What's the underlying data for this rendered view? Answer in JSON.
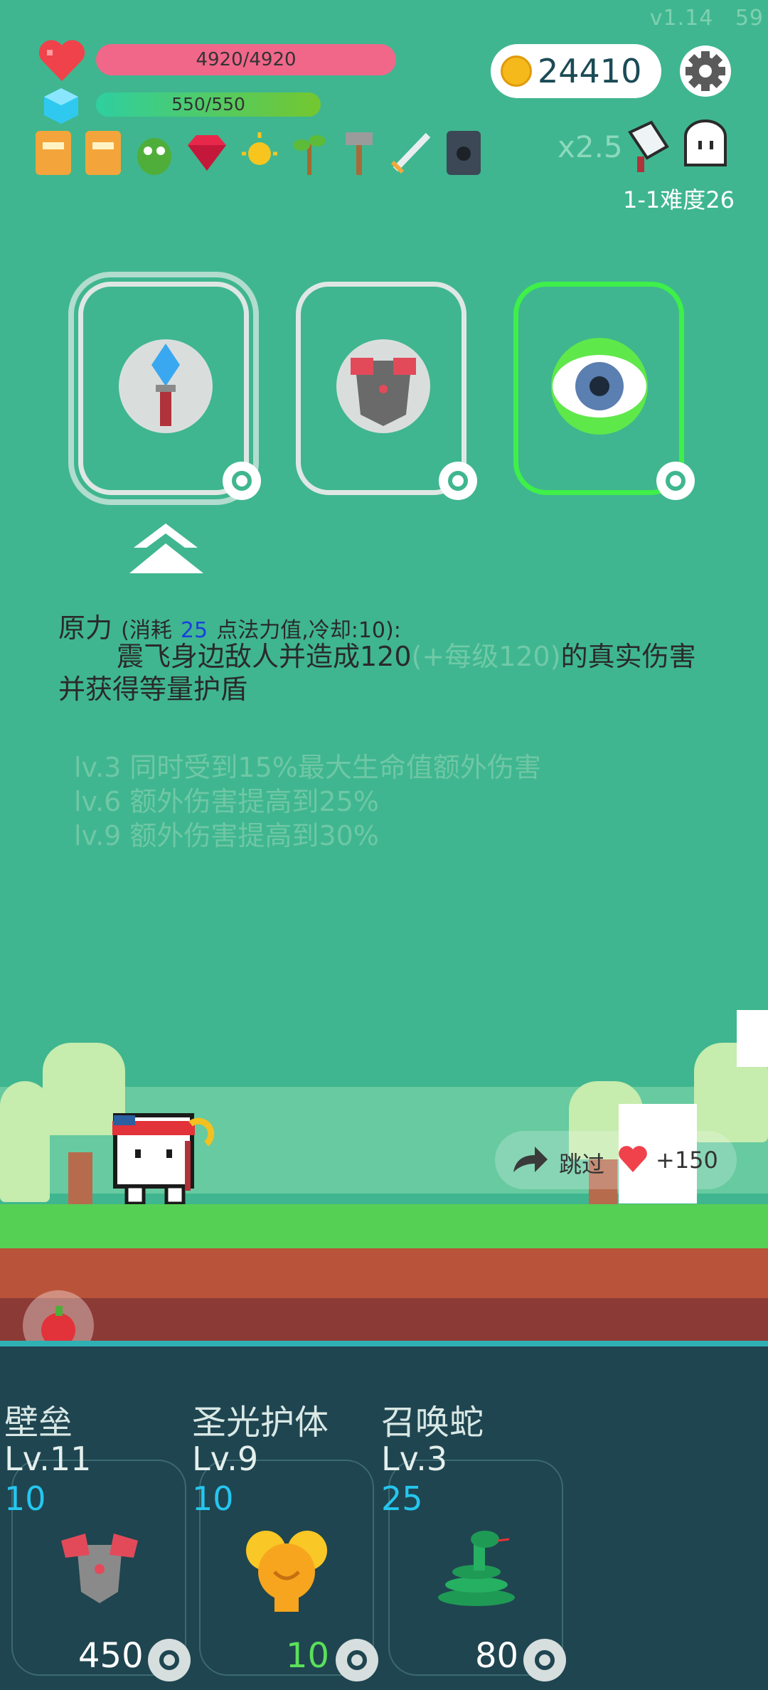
{
  "version": "v1.14  59",
  "hud": {
    "hp_text": "4920/4920",
    "mp_text": "550/550",
    "coins": "24410",
    "multiplier": "x2.5",
    "stage_label": "1-1难度26",
    "items": [
      "book-icon",
      "book-icon",
      "green-monster-icon",
      "ruby-icon",
      "sun-icon",
      "sapling-icon",
      "hammer-icon",
      "sword-icon",
      "skull-tome-icon"
    ]
  },
  "cards": [
    {
      "name": "crystal-staff-card",
      "icon": "crystal-staff-icon"
    },
    {
      "name": "armor-card",
      "icon": "armor-icon"
    },
    {
      "name": "eye-card",
      "icon": "eye-icon"
    }
  ],
  "desc": {
    "title": "原力",
    "cost_prefix": "(消耗",
    "cost": "25",
    "cost_suffix": "点法力值,冷却:10):",
    "body_main": "震飞身边敌人并造成120",
    "body_dim": "(+每级120)",
    "body_end": "的真实伤害并获得等量护盾",
    "levels": [
      "lv.3 同时受到15%最大生命值额外伤害",
      "lv.6 额外伤害提高到25%",
      "lv.9 额外伤害提高到30%"
    ]
  },
  "skip": {
    "label": "跳过",
    "reward": "+150"
  },
  "skills": [
    {
      "name": "壁垒",
      "level": "Lv.11",
      "cost": "10",
      "price": "450"
    },
    {
      "name": "圣光护体",
      "level": "Lv.9",
      "cost": "10",
      "price": "10"
    },
    {
      "name": "召唤蛇",
      "level": "Lv.3",
      "cost": "25",
      "price": "80"
    }
  ],
  "colors": {
    "background": "#3fb68f",
    "hp": "#f0678a",
    "panel": "#1f4550",
    "card_highlight": "#3fef4a"
  }
}
